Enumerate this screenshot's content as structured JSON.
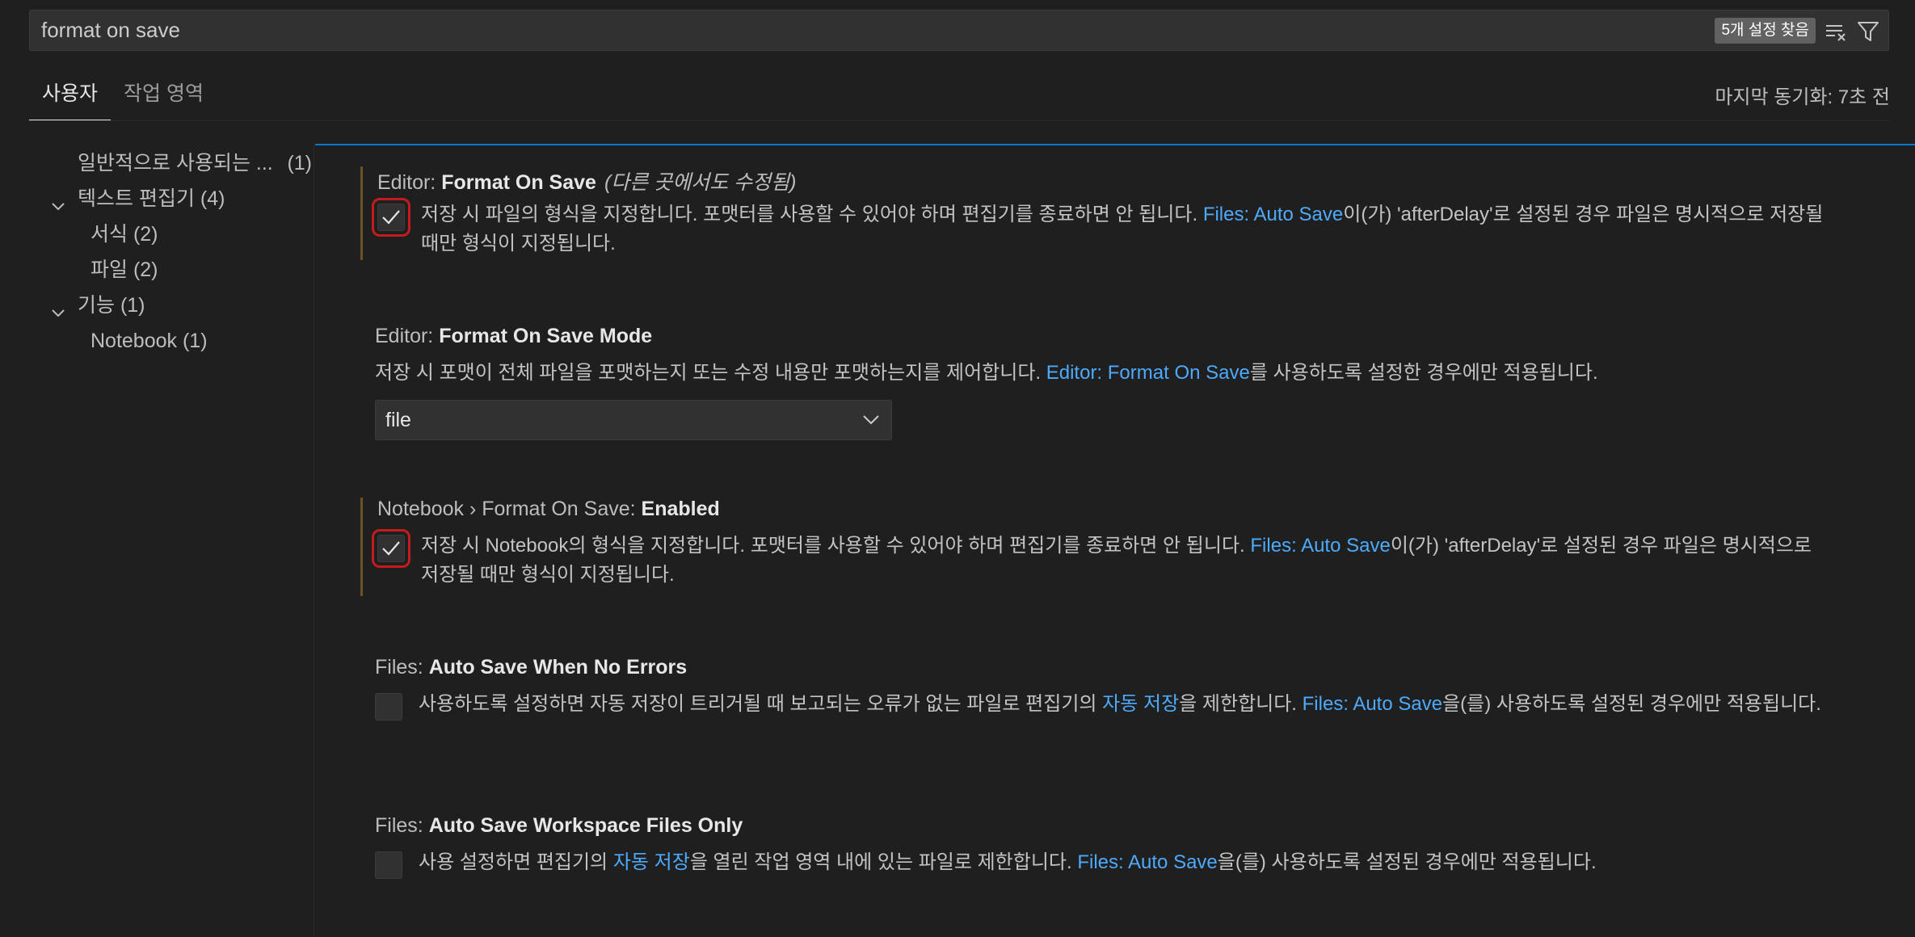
{
  "search": {
    "value": "format on save",
    "results_badge": "5개 설정 찾음"
  },
  "tabs": [
    {
      "label": "사용자",
      "active": true
    },
    {
      "label": "작업 영역",
      "active": false
    }
  ],
  "sync_status": "마지막 동기화: 7초 전",
  "toc": [
    {
      "label": "일반적으로 사용되는 ...",
      "count": "(1)"
    },
    {
      "label": "텍스트 편집기 (4)",
      "expanded": true
    },
    {
      "label": "서식 (2)"
    },
    {
      "label": "파일 (2)"
    },
    {
      "label": "기능 (1)",
      "expanded": true
    },
    {
      "label": "Notebook (1)"
    }
  ],
  "settings": {
    "format_on_save": {
      "category": "Editor: ",
      "name": "Format On Save",
      "modified_note": "(다른 곳에서도 수정됨)",
      "checked": true,
      "desc1": "저장 시 파일의 형식을 지정합니다. 포맷터를 사용할 수 있어야 하며 편집기를 종료하면 안 됩니다. ",
      "link1": "Files: Auto Save",
      "desc2": "이(가) 'afterDelay'로 설정된 경우 파일은 명시적으로 저장될 때만 형식이 지정됩니다."
    },
    "format_on_save_mode": {
      "category": "Editor: ",
      "name": "Format On Save Mode",
      "desc1": "저장 시 포맷이 전체 파일을 포맷하는지 또는 수정 내용만 포맷하는지를 제어합니다. ",
      "link1": "Editor: Format On Save",
      "desc2": "를 사용하도록 설정한 경우에만 적용됩니다.",
      "selected": "file"
    },
    "notebook_format_on_save": {
      "category": "Notebook › Format On Save: ",
      "name": "Enabled",
      "checked": true,
      "desc1": "저장 시 Notebook의 형식을 지정합니다. 포맷터를 사용할 수 있어야 하며 편집기를 종료하면 안 됩니다. ",
      "link1": "Files: Auto Save",
      "desc2": "이(가) 'afterDelay'로 설정된 경우 파일은 명시적으로 저장될 때만 형식이 지정됩니다."
    },
    "auto_save_no_errors": {
      "category": "Files: ",
      "name": "Auto Save When No Errors",
      "checked": false,
      "desc1": "사용하도록 설정하면 자동 저장이 트리거될 때 보고되는 오류가 없는 파일로 편집기의 ",
      "link1": "자동 저장",
      "desc2": "을 제한합니다. ",
      "link2": "Files: Auto Save",
      "desc3": "을(를) 사용하도록 설정된 경우에만 적용됩니다."
    },
    "auto_save_workspace_only": {
      "category": "Files: ",
      "name": "Auto Save Workspace Files Only",
      "checked": false,
      "desc1": "사용 설정하면 편집기의 ",
      "link1": "자동 저장",
      "desc2": "을 열린 작업 영역 내에 있는 파일로 제한합니다. ",
      "link2": "Files: Auto Save",
      "desc3": "을(를) 사용하도록 설정된 경우에만 적용됩니다."
    }
  },
  "colors": {
    "background": "#1f1f1f",
    "link": "#4daafc",
    "focus_outline": "#c31b1e",
    "modified_bar": "#6b5326"
  }
}
